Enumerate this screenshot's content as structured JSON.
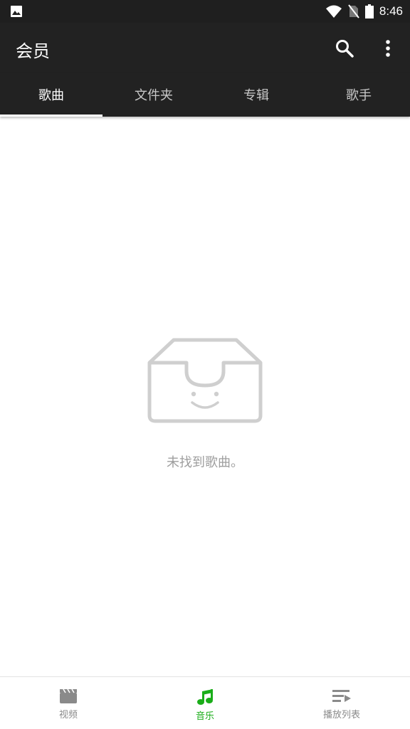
{
  "status_bar": {
    "time": "8:46",
    "icons": [
      "image-icon",
      "wifi-icon",
      "no-sim-icon",
      "battery-icon"
    ]
  },
  "app_bar": {
    "title": "会员",
    "actions": [
      "search-icon",
      "more-vert-icon"
    ]
  },
  "tabs": [
    {
      "label": "歌曲",
      "active": true
    },
    {
      "label": "文件夹",
      "active": false
    },
    {
      "label": "专辑",
      "active": false
    },
    {
      "label": "歌手",
      "active": false
    }
  ],
  "empty_state": {
    "icon": "empty-box-icon",
    "message": "未找到歌曲。"
  },
  "bottom_nav": [
    {
      "label": "视频",
      "icon": "video-icon",
      "active": false
    },
    {
      "label": "音乐",
      "icon": "music-note-icon",
      "active": true
    },
    {
      "label": "播放列表",
      "icon": "playlist-icon",
      "active": false
    }
  ],
  "colors": {
    "app_bar": "#222222",
    "status_bar": "#1f1f1f",
    "accent": "#1aad19",
    "inactive_nav": "#8a8a8a",
    "empty_text": "#9e9e9e"
  }
}
